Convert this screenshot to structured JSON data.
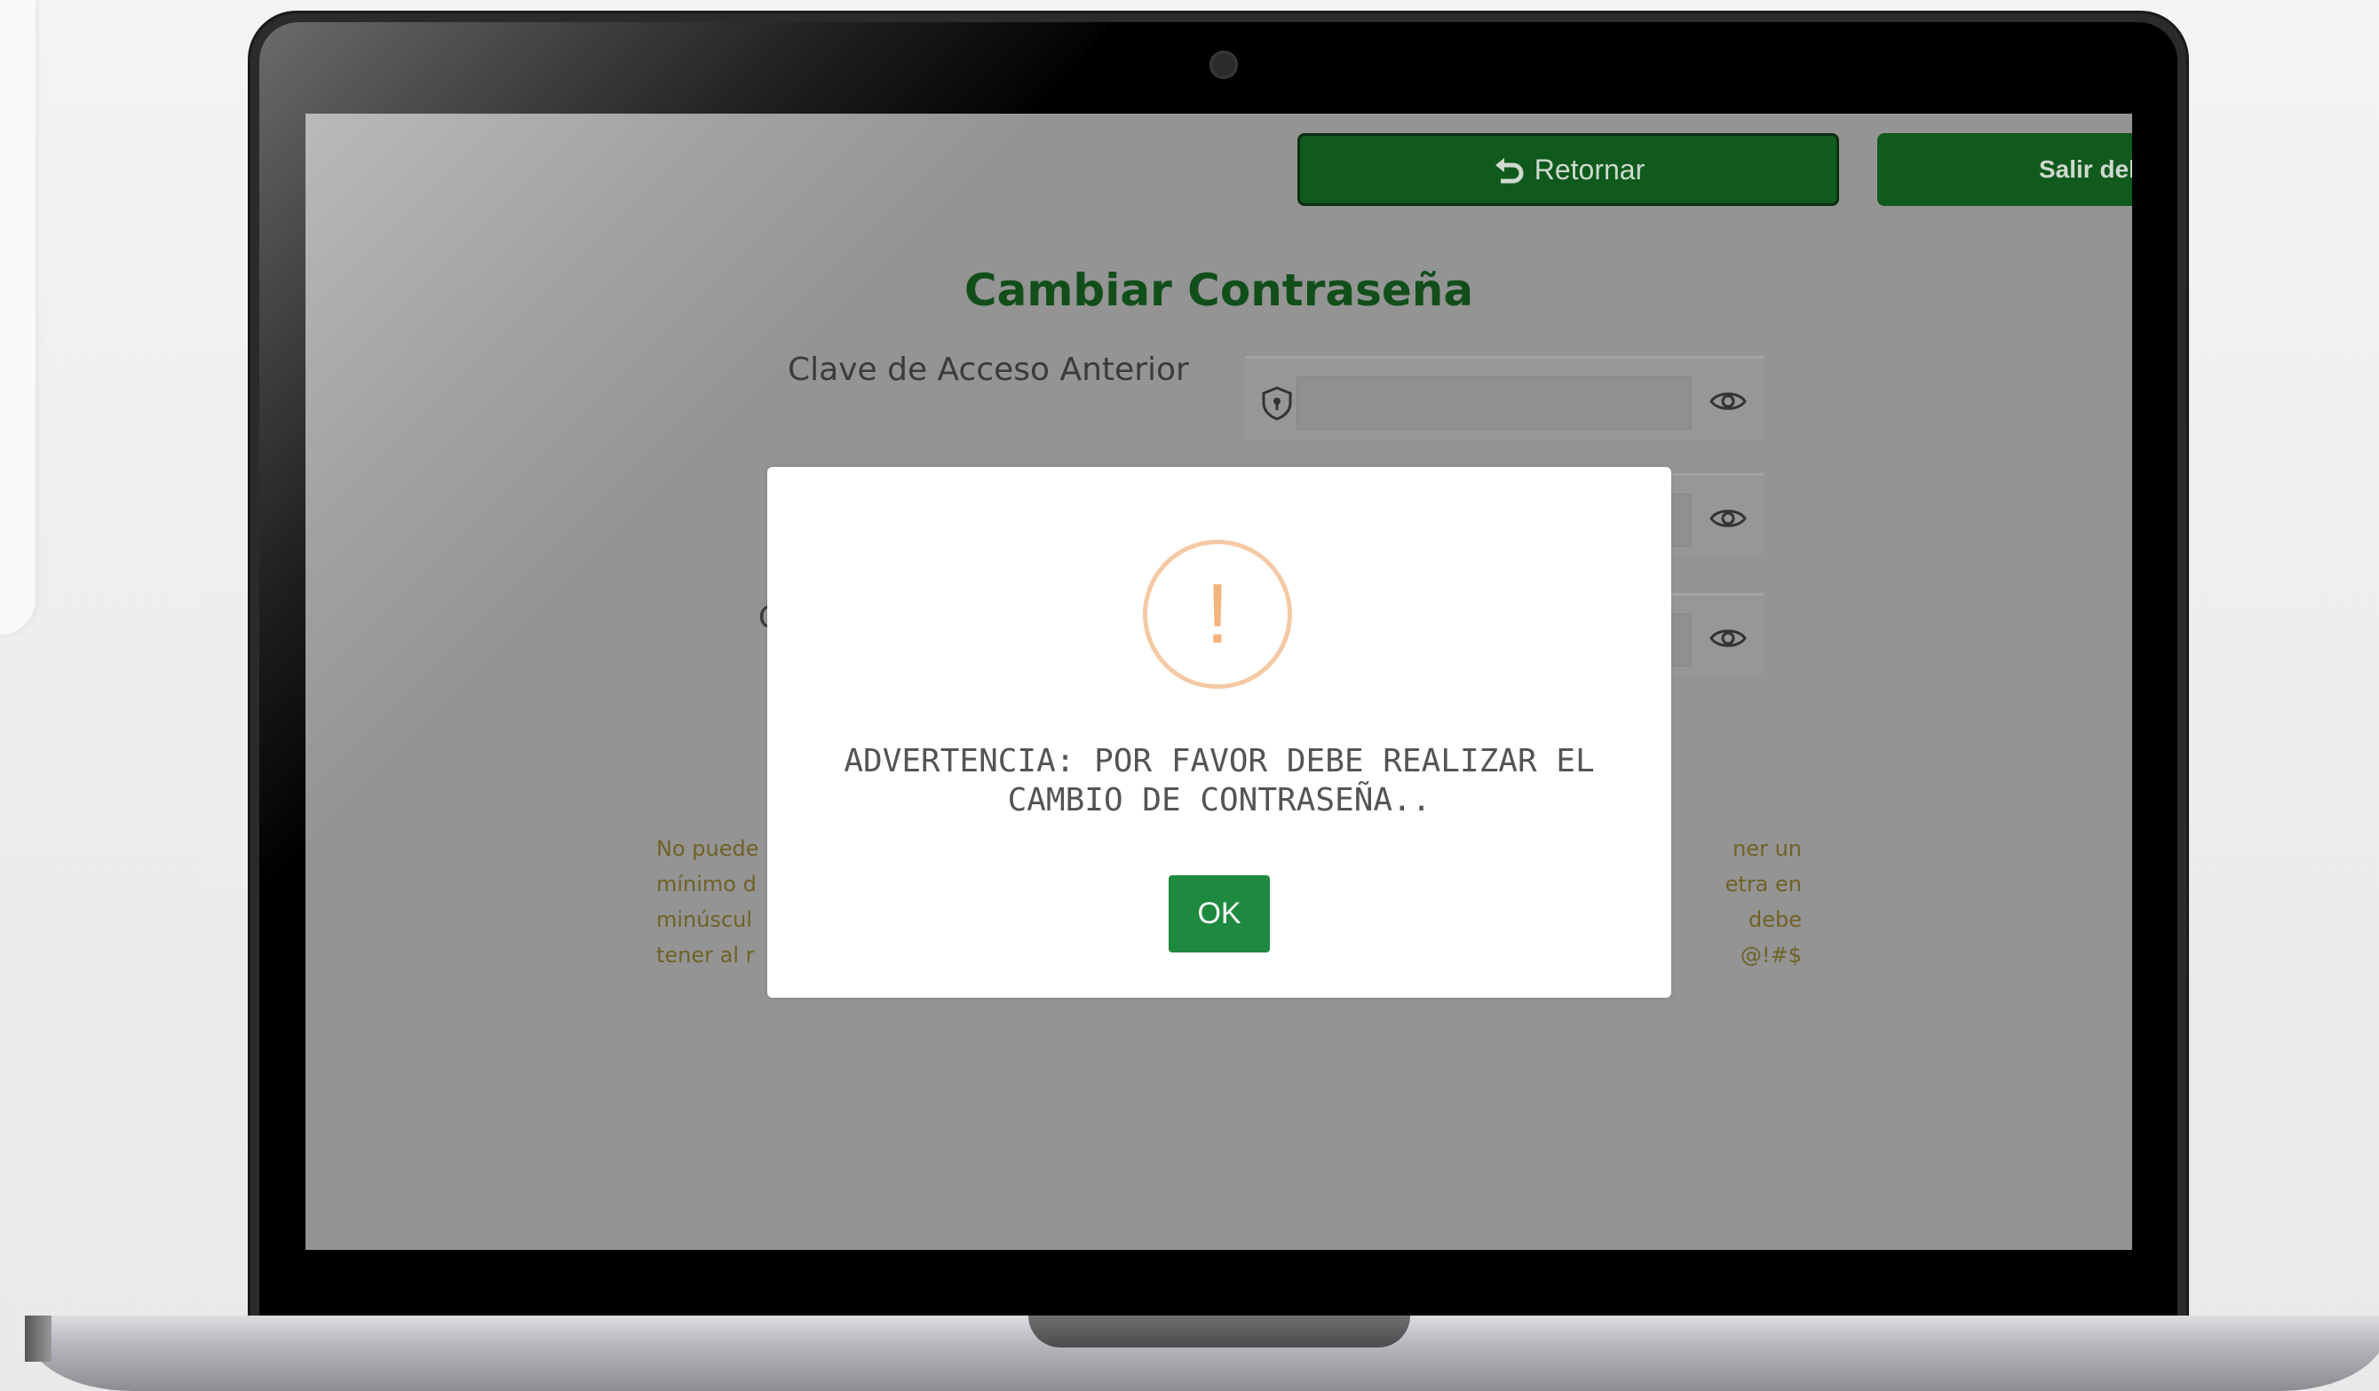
{
  "buttons": {
    "retornar": "Retornar",
    "salir": "Salir del S"
  },
  "page": {
    "title": "Cambiar Contraseña",
    "label_previous_password": "Clave de Acceso Anterior",
    "partial_label": "C"
  },
  "notes": {
    "left": "No puede\nmínimo d\nminúscul\ntener al r",
    "right": "ner un\netra en\n debe\n@!#$"
  },
  "modal": {
    "icon": "exclamation-warning-icon",
    "message_line1": "ADVERTENCIA: POR FAVOR DEBE REALIZAR EL",
    "message_line2": "CAMBIO DE CONTRASEÑA..",
    "ok_label": "OK"
  },
  "colors": {
    "primary_green": "#0f5a1c",
    "ok_green": "#1e8a3f",
    "warning_orange": "#f4b47e",
    "title_green": "#114e1a"
  }
}
